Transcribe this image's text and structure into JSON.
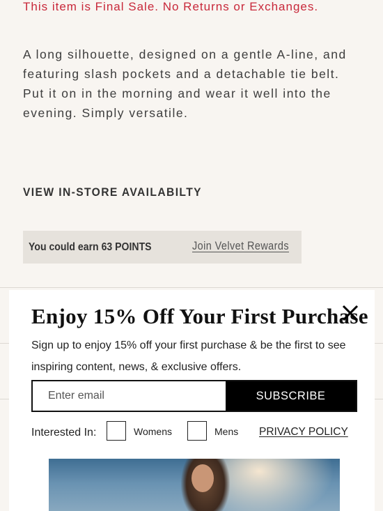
{
  "product": {
    "final_sale": "This item is Final Sale. No Returns or Exchanges.",
    "description": "A long silhouette, designed on a gentle A-line, and featuring slash pockets and a detachable tie belt. Put it on in the morning and wear it well into the evening. Simply versatile.",
    "instore_link": "VIEW IN-STORE AVAILABILTY"
  },
  "rewards": {
    "earn_text": "You could earn 63 POINTS",
    "join_link": "Join Velvet Rewards"
  },
  "modal": {
    "title": "Enjoy 15% Off Your First Purchase",
    "subtitle": "Sign up to enjoy 15% off your first purchase & be the first to see inspiring content, news, & exclusive offers.",
    "email_placeholder": "Enter email",
    "email_value": "",
    "subscribe_label": "SUBSCRIBE",
    "interested_label": "Interested In:",
    "options": [
      {
        "label": "Womens",
        "checked": false
      },
      {
        "label": "Mens",
        "checked": false
      }
    ],
    "privacy_label": "PRIVACY POLICY",
    "close_icon": "close-icon"
  },
  "colors": {
    "final_sale": "#c8283a",
    "page_bg": "#f8f5f1",
    "rewards_bg": "#e6e2dc",
    "button_bg": "#000000"
  }
}
